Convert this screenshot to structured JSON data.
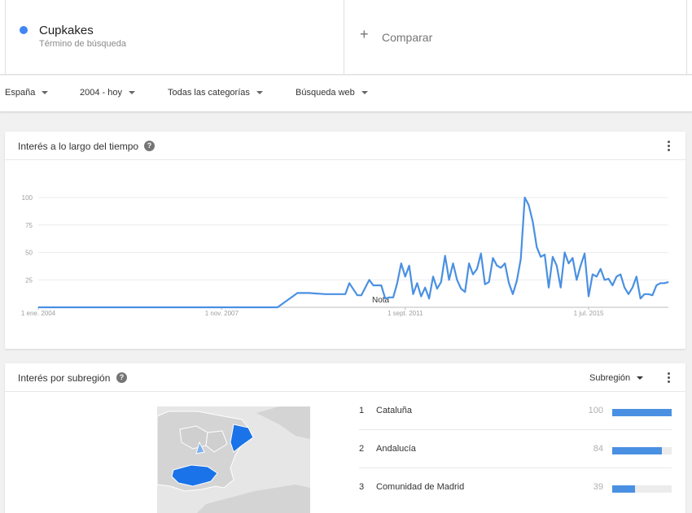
{
  "term": {
    "name": "Cupkakes",
    "subtitle": "Término de búsqueda",
    "color": "#4285f4"
  },
  "compare": {
    "icon": "plus-icon",
    "label": "Comparar"
  },
  "filters": {
    "region": "España",
    "time": "2004 - hoy",
    "category": "Todas las categorías",
    "search_type": "Búsqueda web"
  },
  "interest_time": {
    "title": "Interés a lo largo del tiempo",
    "help_icon": "help-icon",
    "note": "Nota",
    "y_ticks": [
      "100",
      "75",
      "50",
      "25"
    ],
    "x_ticks": [
      "1 ene. 2004",
      "1 nov. 2007",
      "1 sept. 2011",
      "1 jul. 2015"
    ]
  },
  "chart_data": {
    "type": "line",
    "title": "",
    "xlabel": "",
    "ylabel": "",
    "ylim": [
      0,
      100
    ],
    "grid": true,
    "series_color": "#4a90e2",
    "x": [
      "2004-01",
      "2005-01",
      "2006-01",
      "2007-01",
      "2008-01",
      "2009-01",
      "2009-06",
      "2009-09",
      "2010-01",
      "2010-06",
      "2010-07",
      "2010-09",
      "2010-10",
      "2010-12",
      "2011-01",
      "2011-02",
      "2011-03",
      "2011-04",
      "2011-05",
      "2011-06",
      "2011-07",
      "2011-08",
      "2011-09",
      "2011-10",
      "2011-11",
      "2011-12",
      "2012-01",
      "2012-02",
      "2012-03",
      "2012-04",
      "2012-05",
      "2012-06",
      "2012-07",
      "2012-08",
      "2012-09",
      "2012-10",
      "2012-11",
      "2012-12",
      "2013-01",
      "2013-02",
      "2013-03",
      "2013-04",
      "2013-05",
      "2013-06",
      "2013-07",
      "2013-08",
      "2013-09",
      "2013-10",
      "2013-11",
      "2013-12",
      "2014-01",
      "2014-02",
      "2014-03",
      "2014-04",
      "2014-05",
      "2014-06",
      "2014-07",
      "2014-08",
      "2014-09",
      "2014-10",
      "2014-11",
      "2014-12",
      "2015-01",
      "2015-02",
      "2015-03",
      "2015-04",
      "2015-05",
      "2015-06",
      "2015-07",
      "2015-08",
      "2015-09",
      "2015-10",
      "2015-11",
      "2015-12",
      "2016-01",
      "2016-02",
      "2016-03",
      "2016-04",
      "2016-05",
      "2016-06",
      "2016-07",
      "2016-08",
      "2016-09",
      "2016-10",
      "2016-11",
      "2016-12",
      "2017-01",
      "2017-02",
      "2017-03"
    ],
    "values": [
      0,
      0,
      0,
      0,
      0,
      0,
      13,
      13,
      12,
      12,
      22,
      11,
      11,
      25,
      20,
      20,
      20,
      8,
      9,
      9,
      22,
      40,
      28,
      38,
      12,
      22,
      10,
      18,
      8,
      28,
      17,
      23,
      47,
      25,
      40,
      25,
      17,
      14,
      40,
      30,
      35,
      49,
      21,
      23,
      45,
      38,
      36,
      40,
      22,
      12,
      24,
      44,
      100,
      93,
      78,
      55,
      46,
      48,
      18,
      46,
      38,
      18,
      50,
      40,
      45,
      25,
      38,
      49,
      10,
      30,
      28,
      35,
      25,
      26,
      20,
      28,
      30,
      18,
      12,
      18,
      28,
      8,
      12,
      12,
      11,
      20,
      22,
      22,
      23
    ]
  },
  "region": {
    "title": "Interés por subregión",
    "help_icon": "help-icon",
    "selector": "Subregión",
    "items": [
      {
        "rank": "1",
        "name": "Cataluña",
        "value": 100
      },
      {
        "rank": "2",
        "name": "Andalucía",
        "value": 84
      },
      {
        "rank": "3",
        "name": "Comunidad de Madrid",
        "value": 39
      }
    ]
  }
}
